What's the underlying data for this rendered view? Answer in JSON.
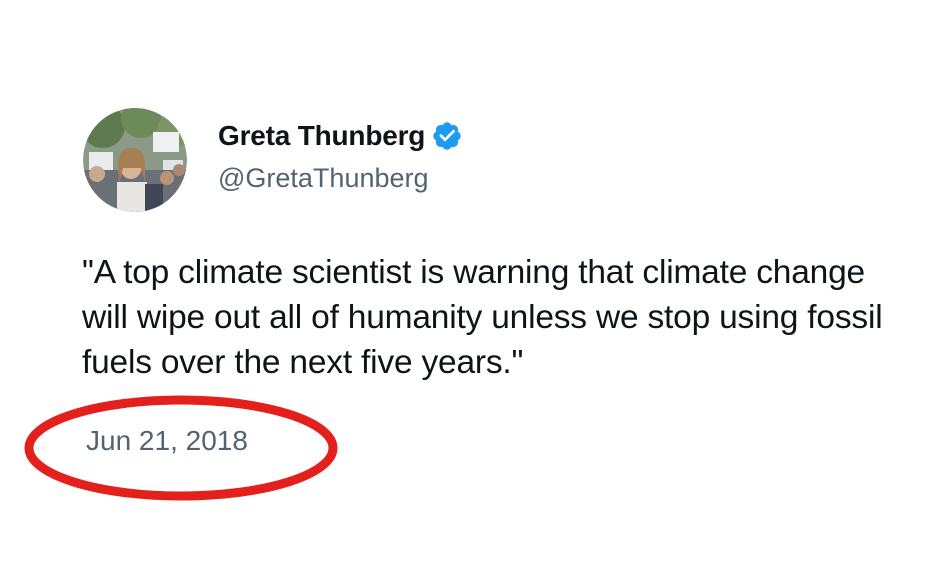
{
  "tweet": {
    "author": {
      "display_name": "Greta Thunberg",
      "handle": "@GretaThunberg",
      "verified": true,
      "avatar_icon": "profile-photo",
      "verified_icon": "verified-badge-icon"
    },
    "text": "\"A top climate scientist is warning that climate change will wipe out all of humanity unless we stop using fossil fuels over the next five years.\"",
    "timestamp": "Jun 21, 2018"
  },
  "colors": {
    "name_text": "#0f1419",
    "secondary_text": "#536471",
    "verified_badge": "#1d9bf0",
    "highlight_circle": "#e3201b",
    "background": "#ffffff"
  }
}
